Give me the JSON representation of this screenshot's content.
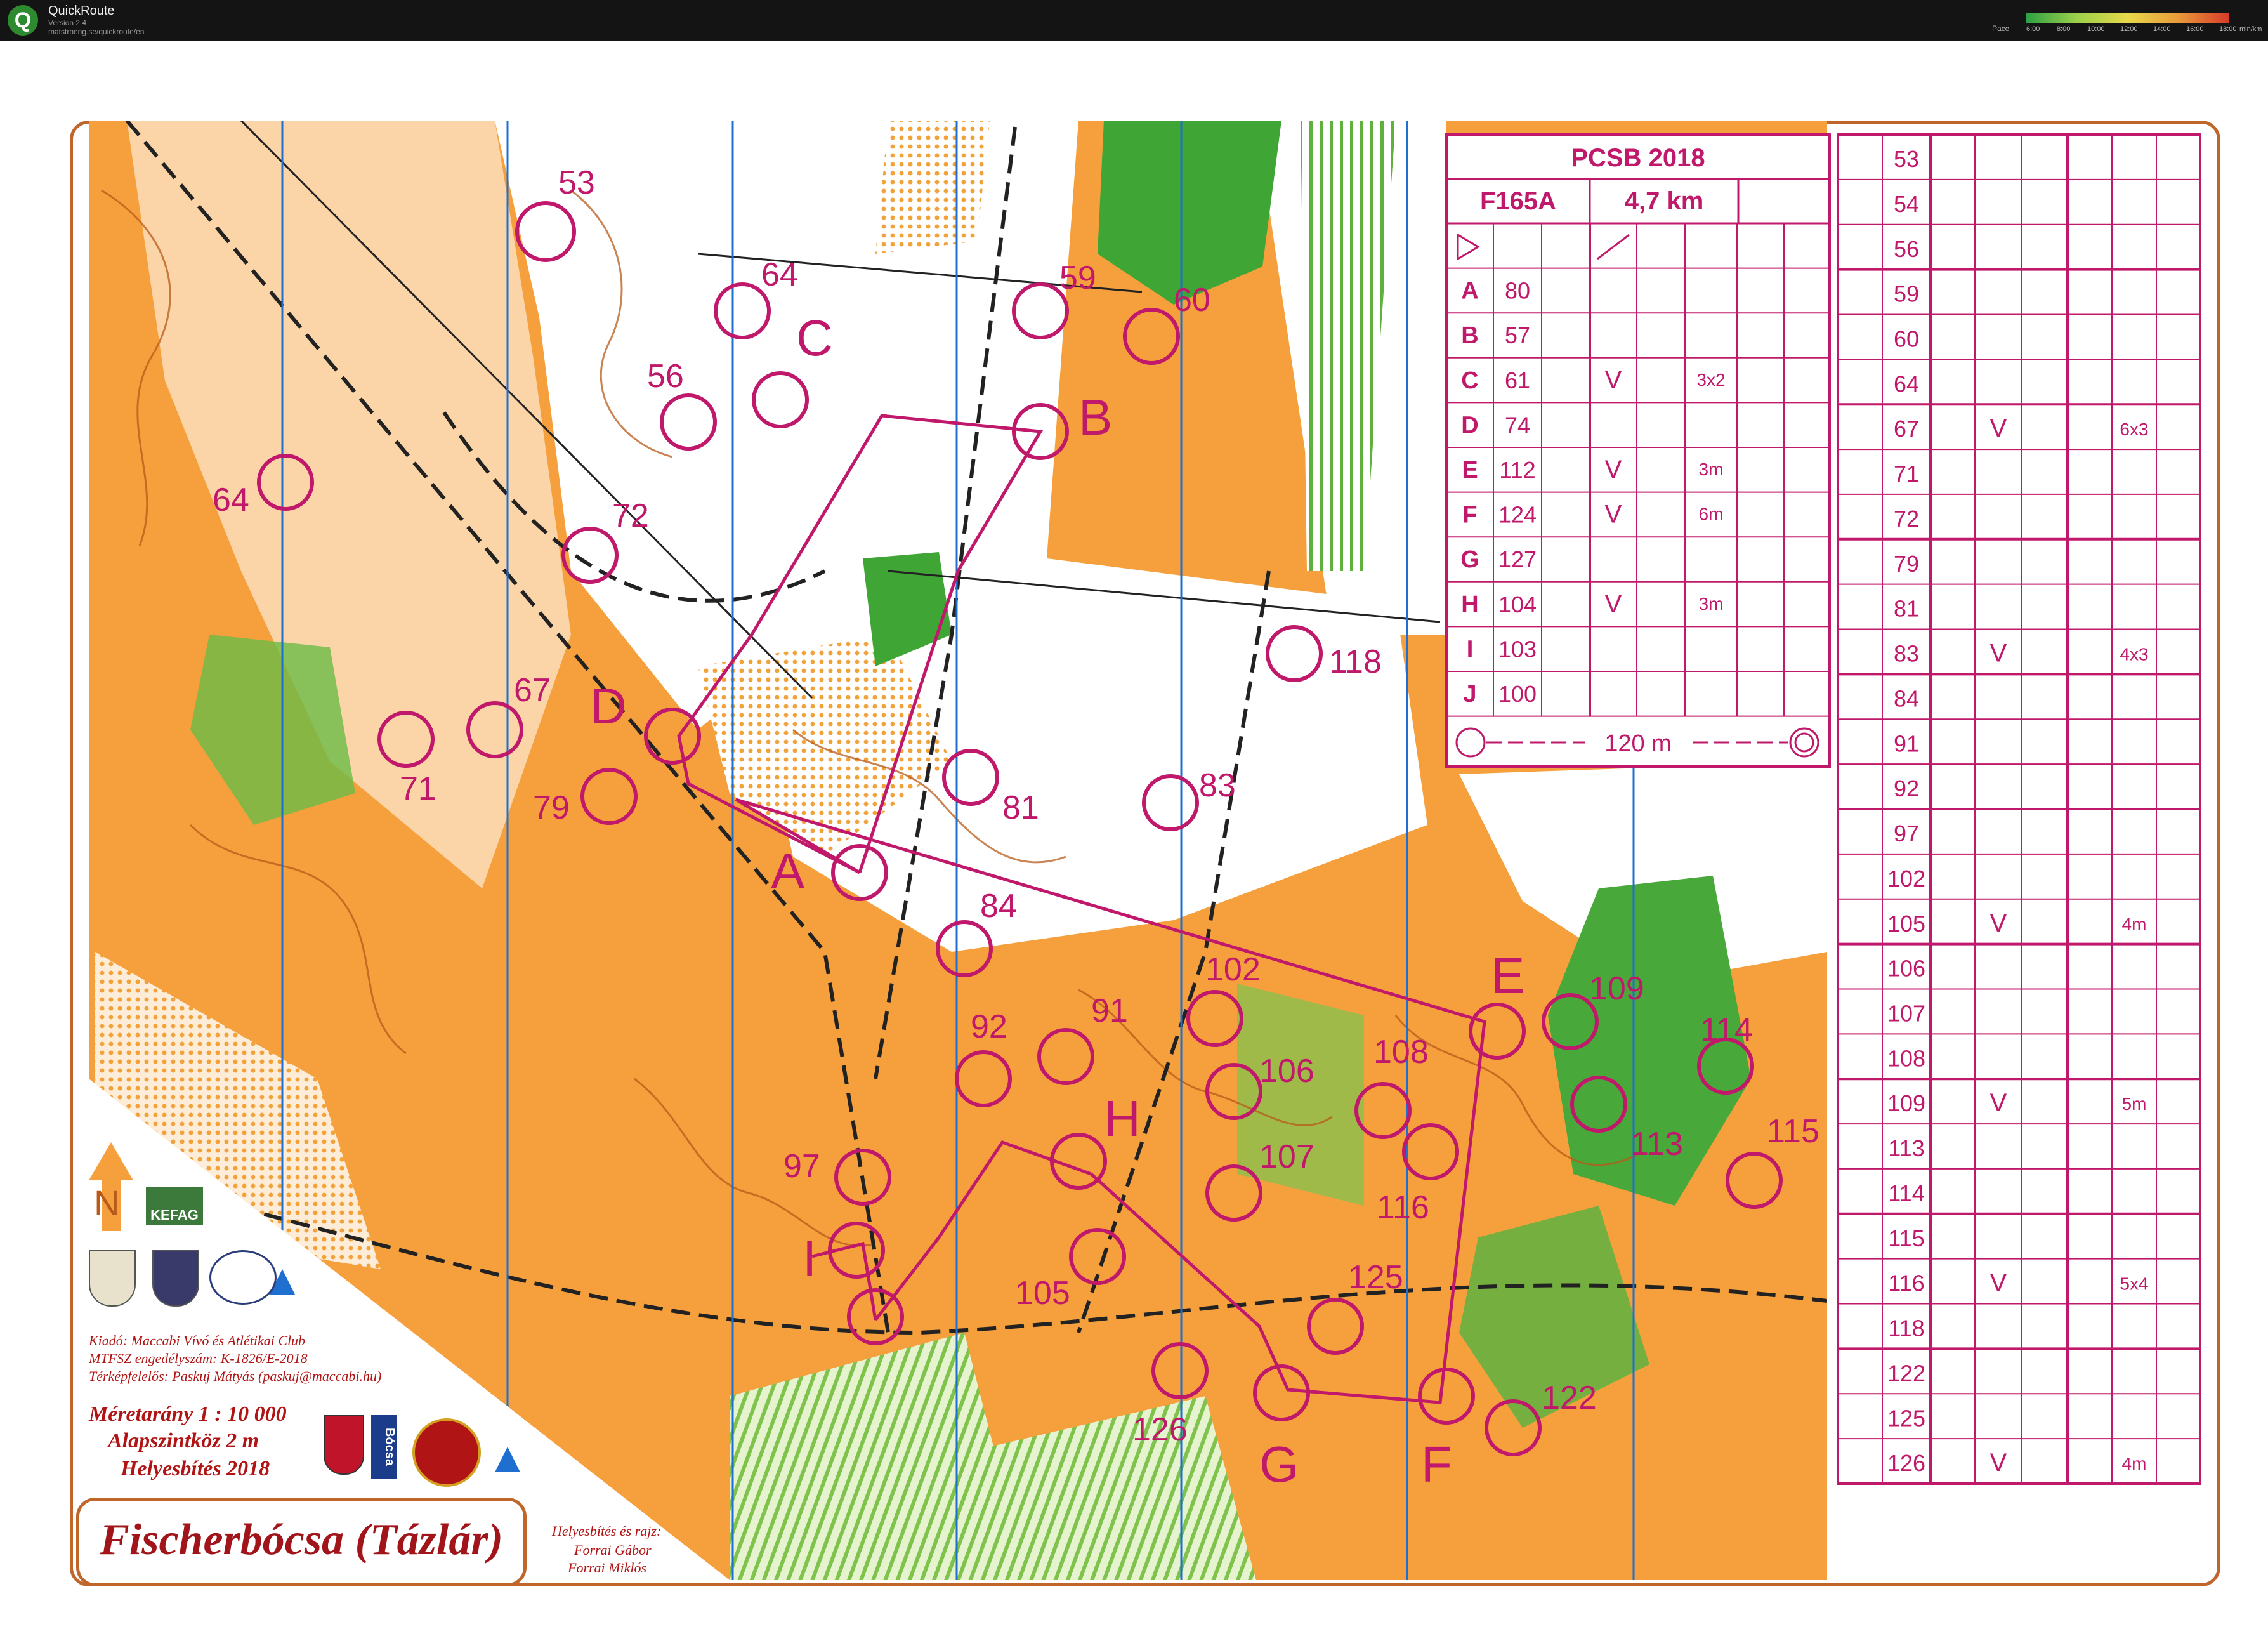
{
  "app": {
    "name": "QuickRoute",
    "version": "Version 2.4",
    "url": "matstroeng.se/quickroute/en",
    "pace_label": "Pace",
    "pace_ticks": [
      "6:00",
      "8:00",
      "10:00",
      "12:00",
      "14:00",
      "16:00",
      "18:00"
    ],
    "pace_unit": "min/km"
  },
  "map": {
    "title": "Fischerbócsa (Tázlár)",
    "publisher": "Kiadó: Maccabi Vívó és Atlétikai Club",
    "permit": "MTFSZ engedélyszám: K-1826/E-2018",
    "manager": "Térképfelelős: Paskuj Mátyás (paskuj@maccabi.hu)",
    "scale": "Méretarány   1 : 10 000",
    "contour": "Alapszintköz  2 m",
    "update": "Helyesbítés 2018",
    "drawn_by_label": "Helyesbítés és rajz:",
    "authors": [
      "Forrai Gábor",
      "Forrai Miklós"
    ],
    "logo_kefag": "KEFAG",
    "logo_bocsa": "Bócsa",
    "control_labels": [
      {
        "t": "53"
      },
      {
        "t": "64"
      },
      {
        "t": "C"
      },
      {
        "t": "59"
      },
      {
        "t": "60"
      },
      {
        "t": "56"
      },
      {
        "t": "B"
      },
      {
        "t": "64"
      },
      {
        "t": "72"
      },
      {
        "t": "118"
      },
      {
        "t": "67"
      },
      {
        "t": "D"
      },
      {
        "t": "71"
      },
      {
        "t": "79"
      },
      {
        "t": "81"
      },
      {
        "t": "83"
      },
      {
        "t": "A"
      },
      {
        "t": "84"
      },
      {
        "t": "102"
      },
      {
        "t": "E"
      },
      {
        "t": "109"
      },
      {
        "t": "91"
      },
      {
        "t": "92"
      },
      {
        "t": "106"
      },
      {
        "t": "108"
      },
      {
        "t": "114"
      },
      {
        "t": "H"
      },
      {
        "t": "113"
      },
      {
        "t": "115"
      },
      {
        "t": "97"
      },
      {
        "t": "107"
      },
      {
        "t": "116"
      },
      {
        "t": "I"
      },
      {
        "t": "105"
      },
      {
        "t": "125"
      },
      {
        "t": "126"
      },
      {
        "t": "G"
      },
      {
        "t": "F"
      },
      {
        "t": "122"
      }
    ]
  },
  "description": {
    "event": "PCSB 2018",
    "course": "F165A",
    "length": "4,7 km",
    "rows": [
      {
        "code": "A",
        "num": "80",
        "c": "",
        "d": "",
        "e": "",
        "g": "",
        "h": ""
      },
      {
        "code": "B",
        "num": "57",
        "c": "",
        "d": "",
        "e": "",
        "g": "",
        "h": ""
      },
      {
        "code": "C",
        "num": "61",
        "c": "",
        "d": "V",
        "e": "",
        "g": "3x2",
        "h": ""
      },
      {
        "code": "D",
        "num": "74",
        "c": "",
        "d": "",
        "e": "",
        "g": "",
        "h": ""
      },
      {
        "code": "E",
        "num": "112",
        "c": "",
        "d": "V",
        "e": "",
        "g": "3m",
        "h": ""
      },
      {
        "code": "F",
        "num": "124",
        "c": "",
        "d": "V",
        "e": "",
        "g": "6m",
        "h": ""
      },
      {
        "code": "G",
        "num": "127",
        "c": "",
        "d": "",
        "e": "",
        "g": "",
        "h": ""
      },
      {
        "code": "H",
        "num": "104",
        "c": "",
        "d": "V",
        "e": "",
        "g": "3m",
        "h": ""
      },
      {
        "code": "I",
        "num": "103",
        "c": "",
        "d": "",
        "e": "",
        "g": "",
        "h": ""
      },
      {
        "code": "J",
        "num": "100",
        "c": "",
        "d": "",
        "e": "",
        "g": "",
        "h": ""
      }
    ],
    "finish": "120 m",
    "rows2": [
      {
        "num": "53",
        "d": "",
        "g": ""
      },
      {
        "num": "54",
        "d": "",
        "g": ""
      },
      {
        "num": "56",
        "d": "",
        "g": ""
      },
      {
        "num": "59",
        "d": "",
        "g": ""
      },
      {
        "num": "60",
        "d": "",
        "g": ""
      },
      {
        "num": "64",
        "d": "",
        "g": ""
      },
      {
        "num": "67",
        "d": "V",
        "g": "6x3"
      },
      {
        "num": "71",
        "d": "",
        "g": ""
      },
      {
        "num": "72",
        "d": "",
        "g": ""
      },
      {
        "num": "79",
        "d": "",
        "g": ""
      },
      {
        "num": "81",
        "d": "",
        "g": ""
      },
      {
        "num": "83",
        "d": "V",
        "g": "4x3"
      },
      {
        "num": "84",
        "d": "",
        "g": ""
      },
      {
        "num": "91",
        "d": "",
        "g": ""
      },
      {
        "num": "92",
        "d": "",
        "g": ""
      },
      {
        "num": "97",
        "d": "",
        "g": ""
      },
      {
        "num": "102",
        "d": "",
        "g": ""
      },
      {
        "num": "105",
        "d": "V",
        "g": "4m"
      },
      {
        "num": "106",
        "d": "",
        "g": ""
      },
      {
        "num": "107",
        "d": "",
        "g": ""
      },
      {
        "num": "108",
        "d": "",
        "g": ""
      },
      {
        "num": "109",
        "d": "V",
        "g": "5m"
      },
      {
        "num": "113",
        "d": "",
        "g": ""
      },
      {
        "num": "114",
        "d": "",
        "g": ""
      },
      {
        "num": "115",
        "d": "",
        "g": ""
      },
      {
        "num": "116",
        "d": "V",
        "g": "5x4"
      },
      {
        "num": "118",
        "d": "",
        "g": ""
      },
      {
        "num": "122",
        "d": "",
        "g": ""
      },
      {
        "num": "125",
        "d": "",
        "g": ""
      },
      {
        "num": "126",
        "d": "V",
        "g": "4m"
      }
    ]
  }
}
